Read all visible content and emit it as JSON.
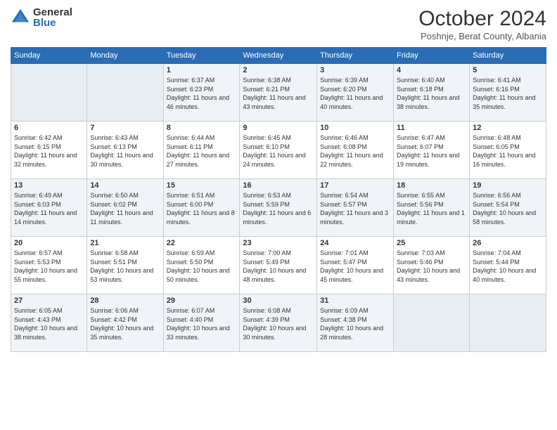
{
  "header": {
    "logo_general": "General",
    "logo_blue": "Blue",
    "month_title": "October 2024",
    "location": "Poshnje, Berat County, Albania"
  },
  "weekdays": [
    "Sunday",
    "Monday",
    "Tuesday",
    "Wednesday",
    "Thursday",
    "Friday",
    "Saturday"
  ],
  "weeks": [
    [
      {
        "day": "",
        "sunrise": "",
        "sunset": "",
        "daylight": ""
      },
      {
        "day": "",
        "sunrise": "",
        "sunset": "",
        "daylight": ""
      },
      {
        "day": "1",
        "sunrise": "Sunrise: 6:37 AM",
        "sunset": "Sunset: 6:23 PM",
        "daylight": "Daylight: 11 hours and 46 minutes."
      },
      {
        "day": "2",
        "sunrise": "Sunrise: 6:38 AM",
        "sunset": "Sunset: 6:21 PM",
        "daylight": "Daylight: 11 hours and 43 minutes."
      },
      {
        "day": "3",
        "sunrise": "Sunrise: 6:39 AM",
        "sunset": "Sunset: 6:20 PM",
        "daylight": "Daylight: 11 hours and 40 minutes."
      },
      {
        "day": "4",
        "sunrise": "Sunrise: 6:40 AM",
        "sunset": "Sunset: 6:18 PM",
        "daylight": "Daylight: 11 hours and 38 minutes."
      },
      {
        "day": "5",
        "sunrise": "Sunrise: 6:41 AM",
        "sunset": "Sunset: 6:16 PM",
        "daylight": "Daylight: 11 hours and 35 minutes."
      }
    ],
    [
      {
        "day": "6",
        "sunrise": "Sunrise: 6:42 AM",
        "sunset": "Sunset: 6:15 PM",
        "daylight": "Daylight: 11 hours and 32 minutes."
      },
      {
        "day": "7",
        "sunrise": "Sunrise: 6:43 AM",
        "sunset": "Sunset: 6:13 PM",
        "daylight": "Daylight: 11 hours and 30 minutes."
      },
      {
        "day": "8",
        "sunrise": "Sunrise: 6:44 AM",
        "sunset": "Sunset: 6:11 PM",
        "daylight": "Daylight: 11 hours and 27 minutes."
      },
      {
        "day": "9",
        "sunrise": "Sunrise: 6:45 AM",
        "sunset": "Sunset: 6:10 PM",
        "daylight": "Daylight: 11 hours and 24 minutes."
      },
      {
        "day": "10",
        "sunrise": "Sunrise: 6:46 AM",
        "sunset": "Sunset: 6:08 PM",
        "daylight": "Daylight: 11 hours and 22 minutes."
      },
      {
        "day": "11",
        "sunrise": "Sunrise: 6:47 AM",
        "sunset": "Sunset: 6:07 PM",
        "daylight": "Daylight: 11 hours and 19 minutes."
      },
      {
        "day": "12",
        "sunrise": "Sunrise: 6:48 AM",
        "sunset": "Sunset: 6:05 PM",
        "daylight": "Daylight: 11 hours and 16 minutes."
      }
    ],
    [
      {
        "day": "13",
        "sunrise": "Sunrise: 6:49 AM",
        "sunset": "Sunset: 6:03 PM",
        "daylight": "Daylight: 11 hours and 14 minutes."
      },
      {
        "day": "14",
        "sunrise": "Sunrise: 6:50 AM",
        "sunset": "Sunset: 6:02 PM",
        "daylight": "Daylight: 11 hours and 11 minutes."
      },
      {
        "day": "15",
        "sunrise": "Sunrise: 6:51 AM",
        "sunset": "Sunset: 6:00 PM",
        "daylight": "Daylight: 11 hours and 8 minutes."
      },
      {
        "day": "16",
        "sunrise": "Sunrise: 6:53 AM",
        "sunset": "Sunset: 5:59 PM",
        "daylight": "Daylight: 11 hours and 6 minutes."
      },
      {
        "day": "17",
        "sunrise": "Sunrise: 6:54 AM",
        "sunset": "Sunset: 5:57 PM",
        "daylight": "Daylight: 11 hours and 3 minutes."
      },
      {
        "day": "18",
        "sunrise": "Sunrise: 6:55 AM",
        "sunset": "Sunset: 5:56 PM",
        "daylight": "Daylight: 11 hours and 1 minute."
      },
      {
        "day": "19",
        "sunrise": "Sunrise: 6:56 AM",
        "sunset": "Sunset: 5:54 PM",
        "daylight": "Daylight: 10 hours and 58 minutes."
      }
    ],
    [
      {
        "day": "20",
        "sunrise": "Sunrise: 6:57 AM",
        "sunset": "Sunset: 5:53 PM",
        "daylight": "Daylight: 10 hours and 55 minutes."
      },
      {
        "day": "21",
        "sunrise": "Sunrise: 6:58 AM",
        "sunset": "Sunset: 5:51 PM",
        "daylight": "Daylight: 10 hours and 53 minutes."
      },
      {
        "day": "22",
        "sunrise": "Sunrise: 6:59 AM",
        "sunset": "Sunset: 5:50 PM",
        "daylight": "Daylight: 10 hours and 50 minutes."
      },
      {
        "day": "23",
        "sunrise": "Sunrise: 7:00 AM",
        "sunset": "Sunset: 5:49 PM",
        "daylight": "Daylight: 10 hours and 48 minutes."
      },
      {
        "day": "24",
        "sunrise": "Sunrise: 7:01 AM",
        "sunset": "Sunset: 5:47 PM",
        "daylight": "Daylight: 10 hours and 45 minutes."
      },
      {
        "day": "25",
        "sunrise": "Sunrise: 7:03 AM",
        "sunset": "Sunset: 5:46 PM",
        "daylight": "Daylight: 10 hours and 43 minutes."
      },
      {
        "day": "26",
        "sunrise": "Sunrise: 7:04 AM",
        "sunset": "Sunset: 5:44 PM",
        "daylight": "Daylight: 10 hours and 40 minutes."
      }
    ],
    [
      {
        "day": "27",
        "sunrise": "Sunrise: 6:05 AM",
        "sunset": "Sunset: 4:43 PM",
        "daylight": "Daylight: 10 hours and 38 minutes."
      },
      {
        "day": "28",
        "sunrise": "Sunrise: 6:06 AM",
        "sunset": "Sunset: 4:42 PM",
        "daylight": "Daylight: 10 hours and 35 minutes."
      },
      {
        "day": "29",
        "sunrise": "Sunrise: 6:07 AM",
        "sunset": "Sunset: 4:40 PM",
        "daylight": "Daylight: 10 hours and 33 minutes."
      },
      {
        "day": "30",
        "sunrise": "Sunrise: 6:08 AM",
        "sunset": "Sunset: 4:39 PM",
        "daylight": "Daylight: 10 hours and 30 minutes."
      },
      {
        "day": "31",
        "sunrise": "Sunrise: 6:09 AM",
        "sunset": "Sunset: 4:38 PM",
        "daylight": "Daylight: 10 hours and 28 minutes."
      },
      {
        "day": "",
        "sunrise": "",
        "sunset": "",
        "daylight": ""
      },
      {
        "day": "",
        "sunrise": "",
        "sunset": "",
        "daylight": ""
      }
    ]
  ]
}
